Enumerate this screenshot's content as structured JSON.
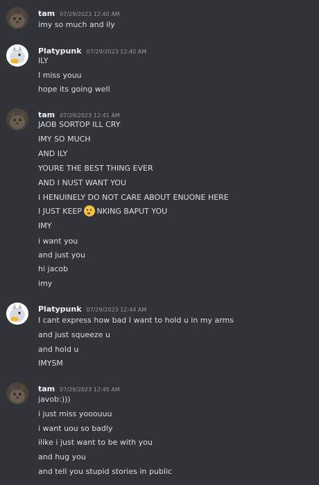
{
  "messages": [
    {
      "author": "tam",
      "timestamp": "07/29/2023 12:40 AM",
      "avatar": "tam-avatar",
      "lines": [
        "imy so much and ily"
      ]
    },
    {
      "author": "Platypunk",
      "timestamp": "07/29/2023 12:40 AM",
      "avatar": "platypunk-avatar",
      "lines": [
        "ILY",
        "I miss youu",
        "hope its going well"
      ]
    },
    {
      "author": "tam",
      "timestamp": "07/29/2023 12:41 AM",
      "avatar": "tam-avatar",
      "lines": [
        "JAOB SORTOP ILL CRY",
        "IMY SO MUCH",
        "AND ILY",
        "YOURE THE BEST THING EVER",
        "AND I NUST WANT YOU",
        "I HENUINELY DO NOT CARE ABOUT ENUONE HERE",
        "I JUST KEEP",
        "IMY",
        "i want you",
        "and just you",
        "hi jacob",
        "imy"
      ],
      "emoji_line": {
        "before": "I JUST KEEP ",
        "emoji": "thinking-face-emoji",
        "after": "NKING BAPUT YOU"
      }
    },
    {
      "author": "Platypunk",
      "timestamp": "07/29/2023 12:44 AM",
      "avatar": "platypunk-avatar",
      "lines": [
        "I cant express how bad I want to hold u in my arms",
        "and just squeeze u",
        "and hold u",
        "IMYSM"
      ]
    },
    {
      "author": "tam",
      "timestamp": "07/29/2023 12:45 AM",
      "avatar": "tam-avatar",
      "lines": [
        "javob:)))",
        "i just miss yooouuu",
        "i want uou so badly",
        "ilike i just want to be with you",
        "and hug you",
        "and tell you stupid stories in public"
      ]
    }
  ],
  "colors": {
    "background": "#313338",
    "username": "#f2f3f5",
    "timestamp": "#949ba4",
    "text": "#dbdee1"
  }
}
